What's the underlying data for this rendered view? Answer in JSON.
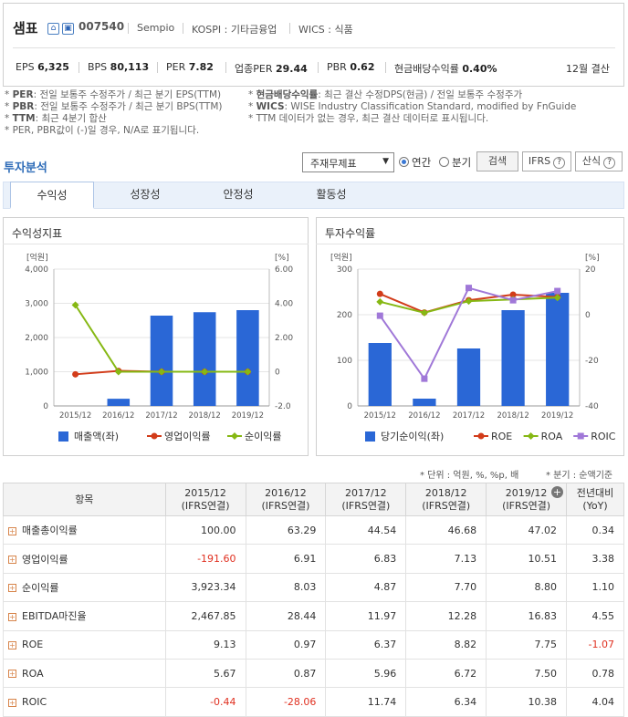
{
  "company": {
    "name": "샘표",
    "code": "007540",
    "eng": "Sempio",
    "market": "KOSPI : 기타금융업",
    "wics": "WICS : 식품"
  },
  "metrics": {
    "eps_label": "EPS",
    "eps": "6,325",
    "bps_label": "BPS",
    "bps": "80,113",
    "per_label": "PER",
    "per": "7.82",
    "ind_per_label": "업종PER",
    "ind_per": "29.44",
    "pbr_label": "PBR",
    "pbr": "0.62",
    "div_label": "현금배당수익률",
    "div": "0.40%",
    "settle": "12월 결산"
  },
  "notes": {
    "l1a": "PER",
    "l1b": ": 전일 보통주 수정주가 / 최근 분기 EPS(TTM)",
    "l1c": "현금배당수익률",
    "l1d": ": 최근 결산 수정DPS(현금) / 전일 보통주 수정주가",
    "l2a": "PBR",
    "l2b": ": 전일 보통주 수정주가 / 최근 분기 BPS(TTM)",
    "l2c": "WICS",
    "l2d": ": WISE Industry Classification Standard, modified by FnGuide",
    "l3a": "TTM",
    "l3b": ": 최근 4분기 합산",
    "l3c": "TTM 데이터가 없는 경우, 최근 결산 데이터로 표시됩니다.",
    "l4": "PER, PBR값이 (-)일 경우, N/A로 표기됩니다."
  },
  "section": {
    "title": "투자분석",
    "select": "주재무제표",
    "radio_year": "연간",
    "radio_quarter": "분기",
    "search": "검색",
    "ifrs": "IFRS",
    "calc": "산식"
  },
  "tabs": [
    "수익성",
    "성장성",
    "안정성",
    "활동성"
  ],
  "chart_data": [
    {
      "type": "bar",
      "title": "수익성지표",
      "left_unit": "[억원]",
      "right_unit": "[%]",
      "categories": [
        "2015/12",
        "2016/12",
        "2017/12",
        "2018/12",
        "2019/12"
      ],
      "ylim_left": [
        0,
        4000
      ],
      "yticks_left": [
        "0",
        "1,000",
        "2,000",
        "3,000",
        "4,000"
      ],
      "ylim_right": [
        -2,
        6
      ],
      "yticks_right": [
        "-2.0",
        "0",
        "2.00",
        "4.00",
        "6.00"
      ],
      "series": [
        {
          "name": "매출액(좌)",
          "axis": "left",
          "kind": "bar",
          "color": "#2a67d6",
          "values": [
            0,
            210,
            2640,
            2740,
            2800
          ]
        },
        {
          "name": "영업이익률",
          "axis": "right",
          "kind": "line",
          "color": "#d23c1a",
          "values": [
            -0.15,
            0.05,
            0.0,
            0.0,
            0.0
          ]
        },
        {
          "name": "순이익률",
          "axis": "right",
          "kind": "line",
          "color": "#86b814",
          "values": [
            3.9,
            0.0,
            0.0,
            0.0,
            0.0
          ]
        }
      ]
    },
    {
      "type": "bar",
      "title": "투자수익률",
      "left_unit": "[억원]",
      "right_unit": "[%]",
      "categories": [
        "2015/12",
        "2016/12",
        "2017/12",
        "2018/12",
        "2019/12"
      ],
      "ylim_left": [
        0,
        300
      ],
      "yticks_left": [
        "0",
        "100",
        "200",
        "300"
      ],
      "ylim_right": [
        -40,
        20
      ],
      "yticks_right": [
        "-40",
        "-20",
        "0",
        "20"
      ],
      "series": [
        {
          "name": "당기순이익(좌)",
          "axis": "left",
          "kind": "bar",
          "color": "#2a67d6",
          "values": [
            138,
            16,
            126,
            210,
            248
          ]
        },
        {
          "name": "ROE",
          "axis": "right",
          "kind": "line",
          "color": "#d23c1a",
          "values": [
            9.13,
            0.97,
            6.37,
            8.82,
            7.75
          ]
        },
        {
          "name": "ROA",
          "axis": "right",
          "kind": "line",
          "color": "#86b814",
          "values": [
            5.67,
            0.87,
            5.96,
            6.72,
            7.5
          ]
        },
        {
          "name": "ROIC",
          "axis": "right",
          "kind": "line",
          "color": "#a078d8",
          "values": [
            -0.44,
            -28.06,
            11.74,
            6.34,
            10.38
          ]
        }
      ]
    }
  ],
  "table": {
    "unit_note": "* 단위 : 억원, %, %p, 배",
    "q_note": "* 분기 : 순액기준",
    "headers": [
      "항목",
      "2015/12\n(IFRS연결)",
      "2016/12\n(IFRS연결)",
      "2017/12\n(IFRS연결)",
      "2018/12\n(IFRS연결)",
      "2019/12\n(IFRS연결)",
      "전년대비\n(YoY)"
    ],
    "rows": [
      {
        "label": "매출총이익률",
        "values": [
          "100.00",
          "63.29",
          "44.54",
          "46.68",
          "47.02",
          "0.34"
        ]
      },
      {
        "label": "영업이익률",
        "values": [
          "-191.60",
          "6.91",
          "6.83",
          "7.13",
          "10.51",
          "3.38"
        ]
      },
      {
        "label": "순이익률",
        "values": [
          "3,923.34",
          "8.03",
          "4.87",
          "7.70",
          "8.80",
          "1.10"
        ]
      },
      {
        "label": "EBITDA마진율",
        "values": [
          "2,467.85",
          "28.44",
          "11.97",
          "12.28",
          "16.83",
          "4.55"
        ]
      },
      {
        "label": "ROE",
        "values": [
          "9.13",
          "0.97",
          "6.37",
          "8.82",
          "7.75",
          "-1.07"
        ]
      },
      {
        "label": "ROA",
        "values": [
          "5.67",
          "0.87",
          "5.96",
          "6.72",
          "7.50",
          "0.78"
        ]
      },
      {
        "label": "ROIC",
        "values": [
          "-0.44",
          "-28.06",
          "11.74",
          "6.34",
          "10.38",
          "4.04"
        ]
      }
    ]
  }
}
